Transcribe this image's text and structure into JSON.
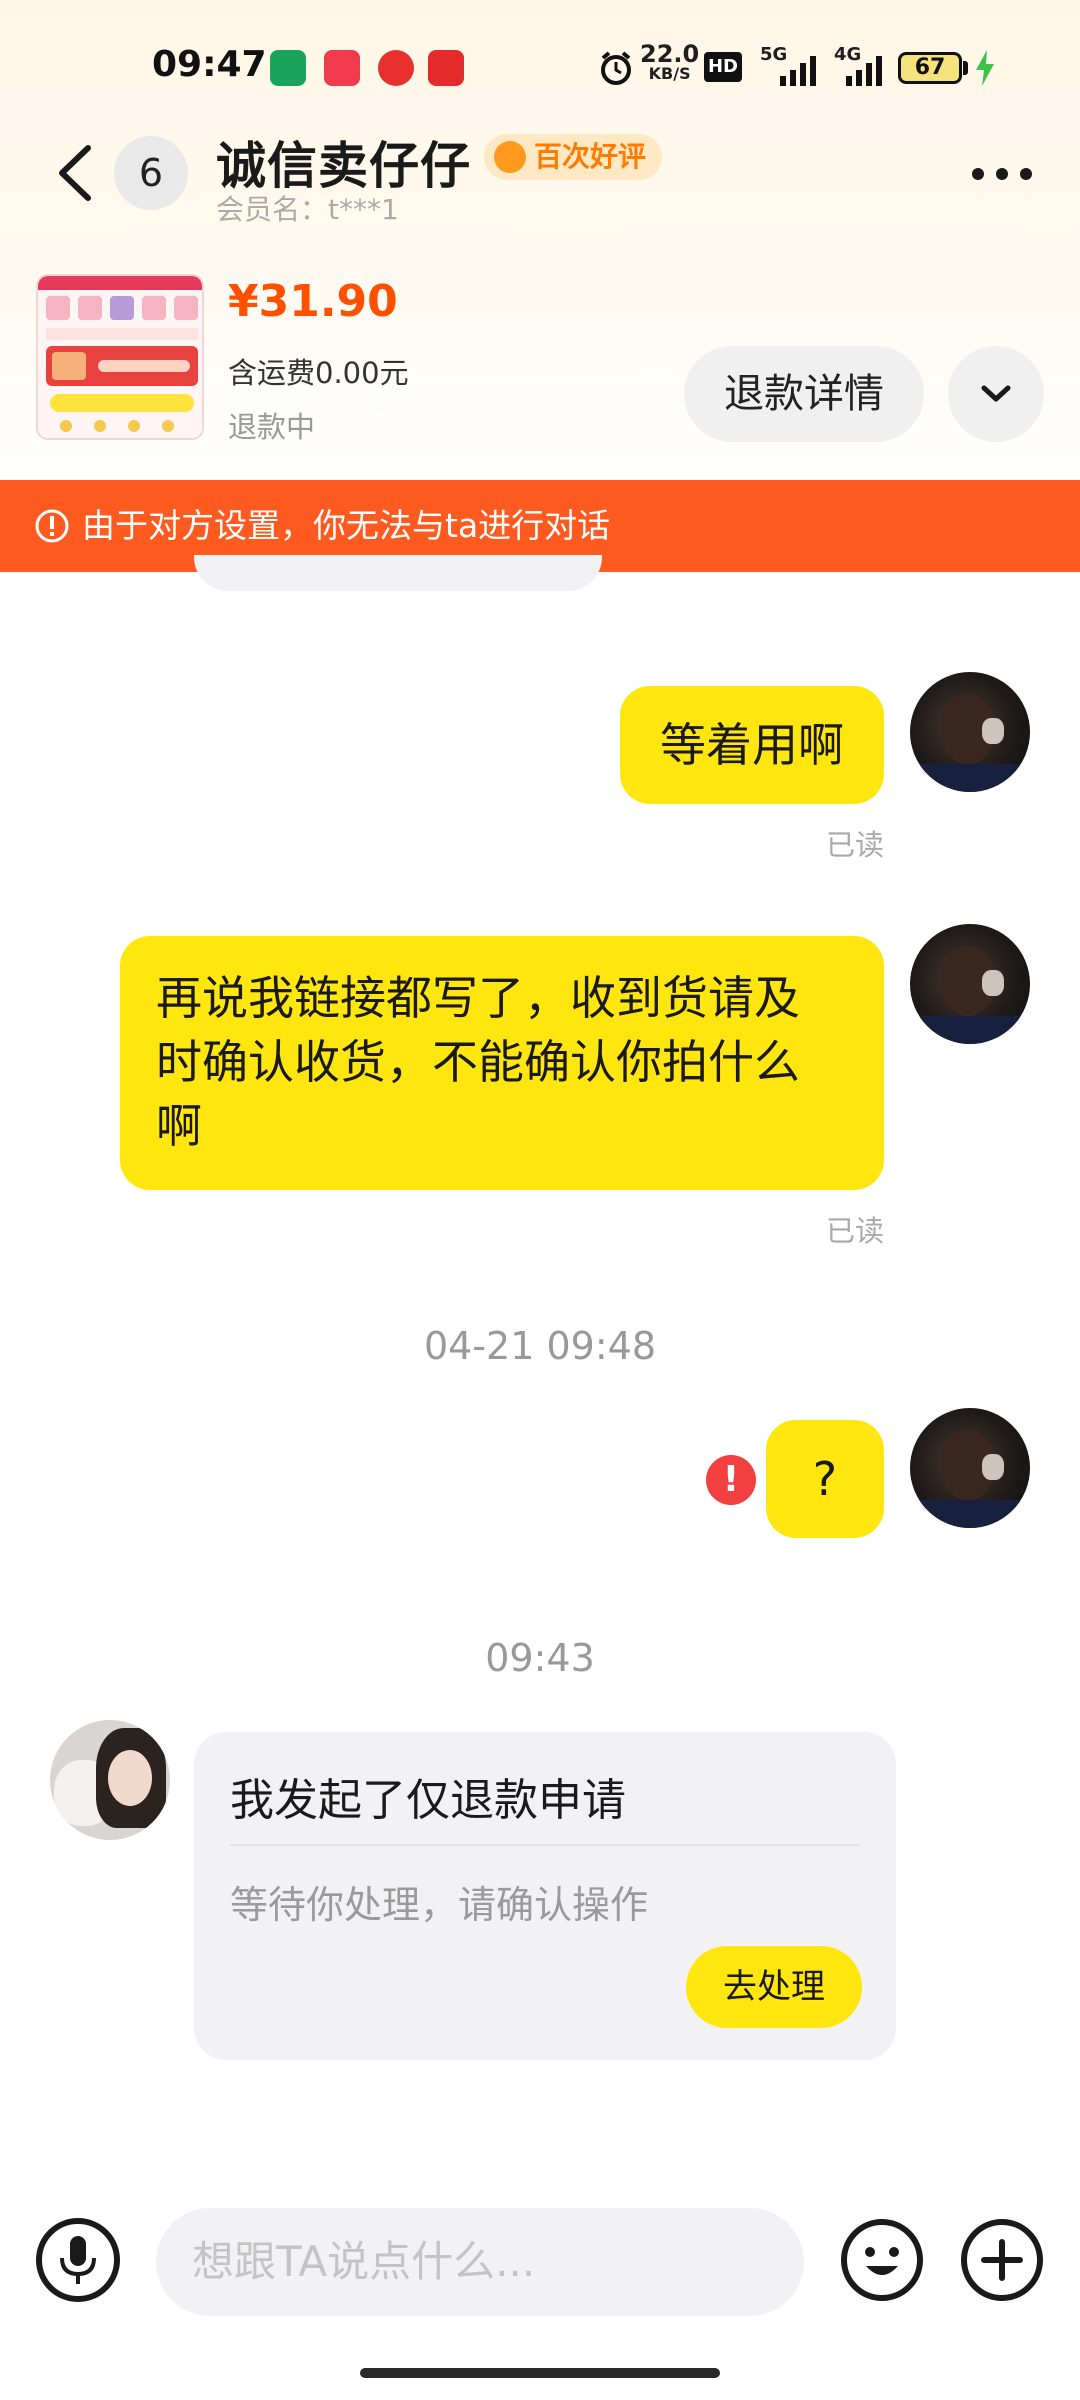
{
  "status_bar": {
    "time": "09:47",
    "net_speed": "22.0",
    "net_unit": "KB/S",
    "hd_label": "HD",
    "signal1_label": "5G",
    "signal2_label": "4G",
    "battery": "67"
  },
  "header": {
    "unread_count": "6",
    "shop_name": "诚信卖仔仔",
    "review_badge": "百次好评",
    "member_name": "会员名：t***1"
  },
  "product": {
    "price": "¥31.90",
    "shipping": "含运费0.00元",
    "status": "退款中",
    "refund_detail_label": "退款详情"
  },
  "warning": {
    "text": "由于对方设置，你无法与ta进行对话"
  },
  "messages": [
    {
      "text": "等着用啊",
      "read": "已读"
    },
    {
      "line1": "再说我链接都写了，收到货请及",
      "line2": "时确认收货，不能确认你拍什么",
      "line3": "啊",
      "read": "已读"
    },
    {
      "text": "?"
    }
  ],
  "timestamps": [
    "04-21 09:48",
    "09:43"
  ],
  "refund_card": {
    "title": "我发起了仅退款申请",
    "subtitle": "等待你处理，请确认操作",
    "action": "去处理"
  },
  "input": {
    "placeholder": "想跟TA说点什么..."
  },
  "colors": {
    "accent_yellow": "#ffe60f",
    "price_orange": "#ff5000",
    "banner_orange": "#ff5a1f",
    "error_red": "#f23f3f"
  },
  "icons": [
    "back-arrow-icon",
    "more-dots-icon",
    "chevron-down-icon",
    "warning-circle-icon",
    "error-icon",
    "microphone-icon",
    "emoji-icon",
    "plus-icon"
  ]
}
